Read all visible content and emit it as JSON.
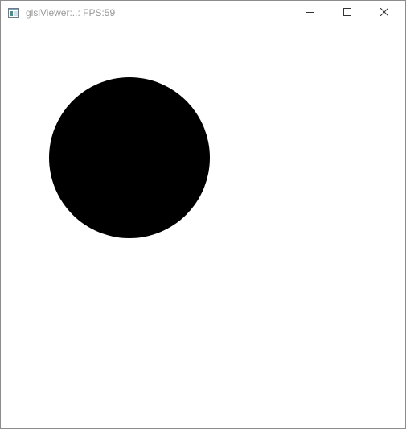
{
  "window": {
    "title": "glslViewer:..: FPS:59",
    "app_icon": "app-window-icon",
    "controls": {
      "minimize_icon": "minimize-icon",
      "maximize_icon": "maximize-icon",
      "close_icon": "close-icon"
    }
  },
  "canvas": {
    "background_color": "#ffffff",
    "shape": "circle",
    "shape_color": "#000000"
  }
}
